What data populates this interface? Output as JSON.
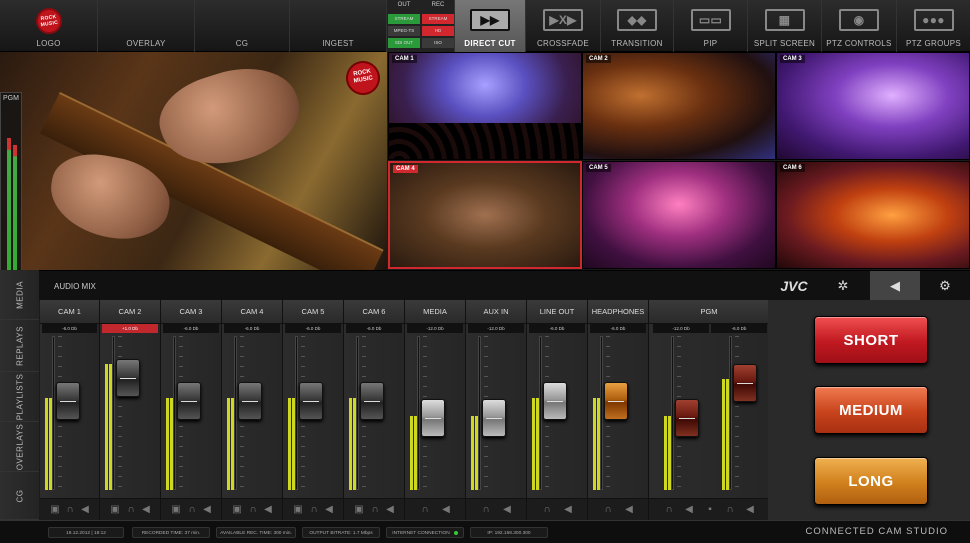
{
  "topbar": {
    "logo": "LOGO",
    "logo_badge": "ROCK MUSIC",
    "overlay": "OVERLAY",
    "cg": "CG",
    "ingest": "INGEST",
    "out_header": "OUT",
    "rec_header": "REC",
    "out_items": [
      "STREAM",
      "MPEG-TS",
      "SDI OUT"
    ],
    "rec_items": [
      "STREAM",
      "HD",
      "ISO"
    ],
    "out_colors": [
      "#2a9a3a",
      "#3a3a3a",
      "#2a9a3a"
    ],
    "rec_colors": [
      "#d0282e",
      "#d0282e",
      "#3a3a3a"
    ],
    "transitions": [
      {
        "label": "DIRECT CUT",
        "icon": "direct-cut-icon",
        "glyph": "▶▶",
        "active": true
      },
      {
        "label": "CROSSFADE",
        "icon": "crossfade-icon",
        "glyph": "▶X▶"
      },
      {
        "label": "TRANSITION",
        "icon": "transition-icon",
        "glyph": "◆◆"
      },
      {
        "label": "PIP",
        "icon": "pip-icon",
        "glyph": "▭▭"
      },
      {
        "label": "SPLIT SCREEN",
        "icon": "split-screen-icon",
        "glyph": "▦"
      },
      {
        "label": "PTZ CONTROLS",
        "icon": "ptz-camera-icon",
        "glyph": "◉"
      },
      {
        "label": "PTZ GROUPS",
        "icon": "ptz-groups-icon",
        "glyph": "●●●"
      }
    ]
  },
  "program": {
    "meter_label": "PGM",
    "logo": "ROCK MUSIC",
    "meter_levels": [
      0.78,
      0.74
    ]
  },
  "cameras": [
    {
      "id": "cam1",
      "label": "CAM 1"
    },
    {
      "id": "cam2",
      "label": "CAM 2"
    },
    {
      "id": "cam3",
      "label": "CAM 3"
    },
    {
      "id": "cam4",
      "label": "CAM 4",
      "selected": true
    },
    {
      "id": "cam5",
      "label": "CAM 5"
    },
    {
      "id": "cam6",
      "label": "CAM 6"
    }
  ],
  "strip": {
    "audio_title": "AUDIO MIX",
    "jvc": "JVC",
    "icons": [
      "gear-icon",
      "speaker-icon",
      "settings-gear-icon"
    ]
  },
  "tabs": [
    "MEDIA",
    "REPLAYS",
    "PLAYLISTS",
    "OVERLAYS",
    "CG"
  ],
  "mixer": {
    "channels": [
      {
        "name": "CAM 1",
        "db": "-6.0 Db",
        "level": 0.6,
        "fader": 0.6,
        "style": "dark"
      },
      {
        "name": "CAM 2",
        "db": "+1.0 Db",
        "level": 0.82,
        "fader": 0.8,
        "style": "dark",
        "hot": true
      },
      {
        "name": "CAM 3",
        "db": "-6.0 Db",
        "level": 0.6,
        "fader": 0.6,
        "style": "dark"
      },
      {
        "name": "CAM 4",
        "db": "-6.0 Db",
        "level": 0.6,
        "fader": 0.6,
        "style": "dark"
      },
      {
        "name": "CAM 5",
        "db": "-6.0 Db",
        "level": 0.6,
        "fader": 0.6,
        "style": "dark"
      },
      {
        "name": "CAM 6",
        "db": "-6.0 Db",
        "level": 0.6,
        "fader": 0.6,
        "style": "dark"
      },
      {
        "name": "MEDIA",
        "db": "-12.0 Db",
        "level": 0.48,
        "fader": 0.46,
        "style": "silver"
      },
      {
        "name": "AUX IN",
        "db": "-12.0 Db",
        "level": 0.48,
        "fader": 0.46,
        "style": "silver"
      },
      {
        "name": "LINE OUT",
        "db": "-6.0 Db",
        "level": 0.6,
        "fader": 0.6,
        "style": "silver"
      },
      {
        "name": "HEADPHONES",
        "db": "-6.0 Db",
        "level": 0.6,
        "fader": 0.6,
        "style": "orange"
      },
      {
        "name": "PGM",
        "db_l": "-12.0 Db",
        "db_r": "-6.0 Db",
        "level_l": 0.48,
        "level_r": 0.72,
        "fader_l": 0.46,
        "fader_r": 0.76,
        "style": "darkred",
        "stereo": true
      }
    ]
  },
  "replay_buttons": {
    "short": "SHORT",
    "medium": "MEDIUM",
    "long": "LONG"
  },
  "status": {
    "date": "18.12.2012 | 18:12",
    "recorded": "RECORDED TIME: 37 min.",
    "available": "AVAILABLE REC. TIME: 300 min.",
    "bitrate": "OUTPUT BITRATE: 1.7 Mbps",
    "internet": "INTERNET CONNECTION",
    "ip": "IP: 192.168.300.300",
    "brand": "CONNECTED CAM STUDIO"
  }
}
